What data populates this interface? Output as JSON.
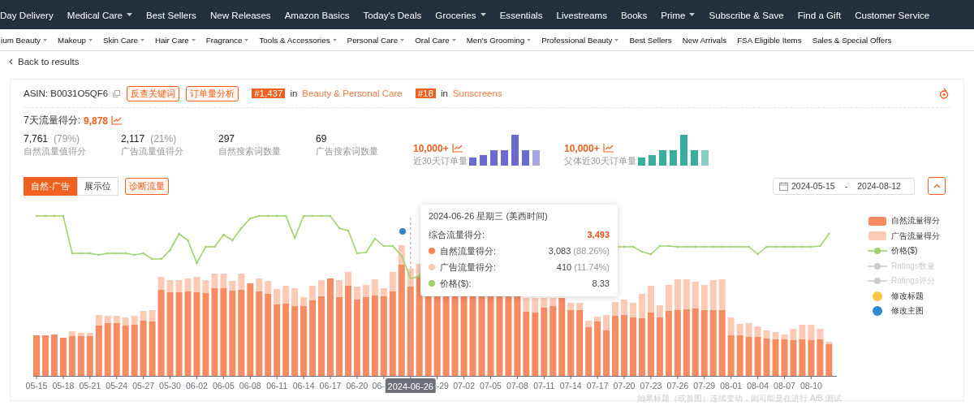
{
  "top_nav": [
    {
      "label": "Day Delivery",
      "dropdown": false
    },
    {
      "label": "Medical Care",
      "dropdown": true
    },
    {
      "label": "Best Sellers",
      "dropdown": false
    },
    {
      "label": "New Releases",
      "dropdown": false
    },
    {
      "label": "Amazon Basics",
      "dropdown": false
    },
    {
      "label": "Today's Deals",
      "dropdown": false
    },
    {
      "label": "Groceries",
      "dropdown": true
    },
    {
      "label": "Essentials",
      "dropdown": false
    },
    {
      "label": "Livestreams",
      "dropdown": false
    },
    {
      "label": "Books",
      "dropdown": false
    },
    {
      "label": "Prime",
      "dropdown": true
    },
    {
      "label": "Subscribe & Save",
      "dropdown": false
    },
    {
      "label": "Find a Gift",
      "dropdown": false
    },
    {
      "label": "Customer Service",
      "dropdown": false
    }
  ],
  "sub_nav": [
    {
      "label": "ium Beauty",
      "dropdown": true
    },
    {
      "label": "Makeup",
      "dropdown": true
    },
    {
      "label": "Skin Care",
      "dropdown": true
    },
    {
      "label": "Hair Care",
      "dropdown": true
    },
    {
      "label": "Fragrance",
      "dropdown": true
    },
    {
      "label": "Tools & Accessories",
      "dropdown": true
    },
    {
      "label": "Personal Care",
      "dropdown": true
    },
    {
      "label": "Oral Care",
      "dropdown": true
    },
    {
      "label": "Men's Grooming",
      "dropdown": true
    },
    {
      "label": "Professional Beauty",
      "dropdown": true
    },
    {
      "label": "Best Sellers",
      "dropdown": false
    },
    {
      "label": "New Arrivals",
      "dropdown": false
    },
    {
      "label": "FSA Eligible Items",
      "dropdown": false
    },
    {
      "label": "Sales & Special Offers",
      "dropdown": false
    }
  ],
  "back_link": "Back to results",
  "product": {
    "asin_label": "ASIN:",
    "asin": "B0031O5QF6",
    "actions": [
      "反查关键词",
      "订单量分析"
    ],
    "ranks": [
      {
        "rank": "#1,437",
        "in": "in",
        "category": "Beauty & Personal Care"
      },
      {
        "rank": "#18",
        "in": "in",
        "category": "Sunscreens"
      }
    ]
  },
  "score": {
    "label": "7天流量得分:",
    "value": "9,878"
  },
  "stats": [
    {
      "kind": "plain",
      "value": "7,761",
      "share": "(79%)",
      "label": "自然流量值得分"
    },
    {
      "kind": "plain",
      "value": "2,117",
      "share": "(21%)",
      "label": "广告流量值得分"
    },
    {
      "kind": "plain",
      "value": "297",
      "label": "自然搜索词数量"
    },
    {
      "kind": "plain",
      "value": "69",
      "label": "广告搜索词数量"
    },
    {
      "kind": "orders",
      "value": "10,000+",
      "label": "近30天订单量",
      "color": "#6b6bcf"
    },
    {
      "kind": "orders",
      "value": "10,000+",
      "label": "父体近30天订单量",
      "color": "#3aae9c"
    }
  ],
  "view_tabs": [
    {
      "label": "自然-广告",
      "selected": true
    },
    {
      "label": "展示位",
      "selected": false
    }
  ],
  "diagnose_button": "诊断流量",
  "date_range": {
    "start": "2024-05-15",
    "separator": "-",
    "end": "2024-08-12"
  },
  "chart": {
    "x_labels": [
      {
        "label": "05-15",
        "selected": false
      },
      {
        "label": "05-18",
        "selected": false
      },
      {
        "label": "05-21",
        "selected": false
      },
      {
        "label": "05-24",
        "selected": false
      },
      {
        "label": "05-27",
        "selected": false
      },
      {
        "label": "05-30",
        "selected": false
      },
      {
        "label": "06-02",
        "selected": false
      },
      {
        "label": "06-05",
        "selected": false
      },
      {
        "label": "06-08",
        "selected": false
      },
      {
        "label": "06-11",
        "selected": false
      },
      {
        "label": "06-14",
        "selected": false
      },
      {
        "label": "06-17",
        "selected": false
      },
      {
        "label": "06-20",
        "selected": false
      },
      {
        "label": "06-",
        "selected": false
      },
      {
        "label": "2024-06-26",
        "selected": true
      },
      {
        "label": "-29",
        "selected": false
      },
      {
        "label": "07-02",
        "selected": false
      },
      {
        "label": "07-05",
        "selected": false
      },
      {
        "label": "07-08",
        "selected": false
      },
      {
        "label": "07-11",
        "selected": false
      },
      {
        "label": "07-14",
        "selected": false
      },
      {
        "label": "07-17",
        "selected": false
      },
      {
        "label": "07-20",
        "selected": false
      },
      {
        "label": "07-23",
        "selected": false
      },
      {
        "label": "07-26",
        "selected": false
      },
      {
        "label": "07-29",
        "selected": false
      },
      {
        "label": "08-01",
        "selected": false
      },
      {
        "label": "08-04",
        "selected": false
      },
      {
        "label": "08-07",
        "selected": false
      },
      {
        "label": "08-10",
        "selected": false
      }
    ],
    "tooltip": {
      "title": "2024-06-26 星期三 (美西时间)",
      "total_label": "综合流量得分:",
      "total_value": "3,493",
      "rows": [
        {
          "label": "自然流量得分:",
          "value": "3,083",
          "share": "(88.26%)",
          "color": "#f5845a"
        },
        {
          "label": "广告流量得分:",
          "value": "410",
          "share": "(11.74%)",
          "color": "#fdc8b3"
        },
        {
          "label": "价格($):",
          "value": "8.33",
          "color": "#9fd36c"
        }
      ]
    },
    "legend": [
      {
        "label": "自然流量得分",
        "kind": "bar",
        "color": "#f78b62",
        "enabled": true
      },
      {
        "label": "广告流量得分",
        "kind": "bar",
        "color": "#fdcab5",
        "enabled": true
      },
      {
        "label": "价格($)",
        "kind": "line",
        "color": "#9fd36c",
        "enabled": true
      },
      {
        "label": "Ratings数量",
        "kind": "line",
        "enabled": false
      },
      {
        "label": "Ratings评分",
        "kind": "line",
        "enabled": false
      },
      {
        "label": "修改标题",
        "kind": "dot",
        "color": "#fcc545",
        "enabled": true
      },
      {
        "label": "修改主图",
        "kind": "dot",
        "color": "#2e87d0",
        "enabled": true
      }
    ],
    "note": "如果标题（或首图）连续变动，则可能是在进行 A/B 测试"
  }
}
